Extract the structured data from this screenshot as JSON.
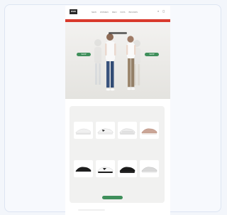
{
  "nav": {
    "logo": "DSW",
    "items": [
      "NEW",
      "WOMEN",
      "MEN",
      "KIDS",
      "BRANDS"
    ],
    "icons": [
      "search-icon",
      "bag-icon"
    ]
  },
  "hero": {
    "caption": "",
    "cta_left": "SHOP",
    "cta_right": "SHOP"
  },
  "products_section": {
    "kicker": "",
    "title": "",
    "button": "",
    "items": [
      {
        "name": "",
        "price": ""
      },
      {
        "name": "",
        "price": ""
      },
      {
        "name": "",
        "price": ""
      },
      {
        "name": "",
        "price": ""
      },
      {
        "name": "",
        "price": ""
      },
      {
        "name": "",
        "price": ""
      },
      {
        "name": "",
        "price": ""
      },
      {
        "name": "",
        "price": ""
      }
    ]
  }
}
